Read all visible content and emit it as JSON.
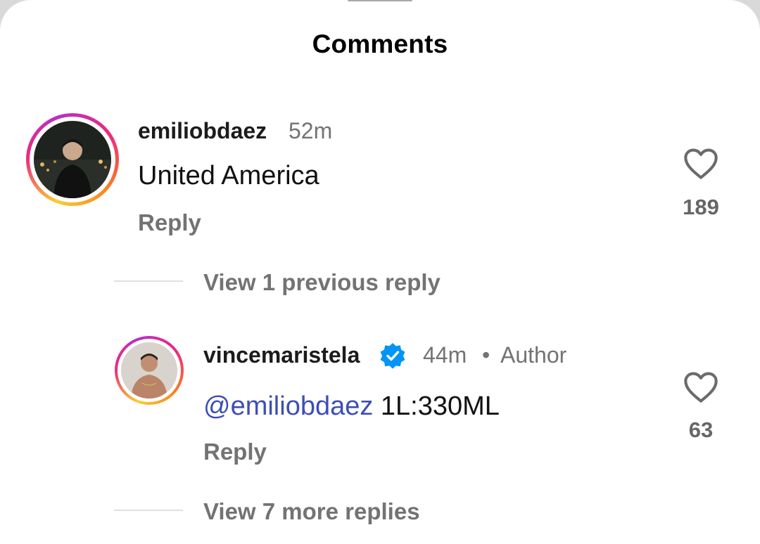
{
  "header": {
    "title": "Comments"
  },
  "comments": [
    {
      "username": "emiliobdaez",
      "time": "52m",
      "text": "United America",
      "reply_label": "Reply",
      "likes": "189",
      "avatar_icon": "profile-photo"
    }
  ],
  "thread_toggles": {
    "previous": "View 1 previous reply",
    "more": "View 7 more replies"
  },
  "replies": [
    {
      "username": "vincemaristela",
      "verified": true,
      "time": "44m",
      "separator": "•",
      "badge": "Author",
      "mention": "@emiliobdaez",
      "text": " 1L:330ML",
      "reply_label": "Reply",
      "likes": "63",
      "avatar_icon": "profile-photo"
    }
  ],
  "colors": {
    "mention": "#3d4fb5",
    "verified_badge": "#0095f6",
    "secondary_text": "#737373"
  },
  "icons": {
    "like": "heart-outline-icon",
    "verified": "verified-badge-icon"
  }
}
